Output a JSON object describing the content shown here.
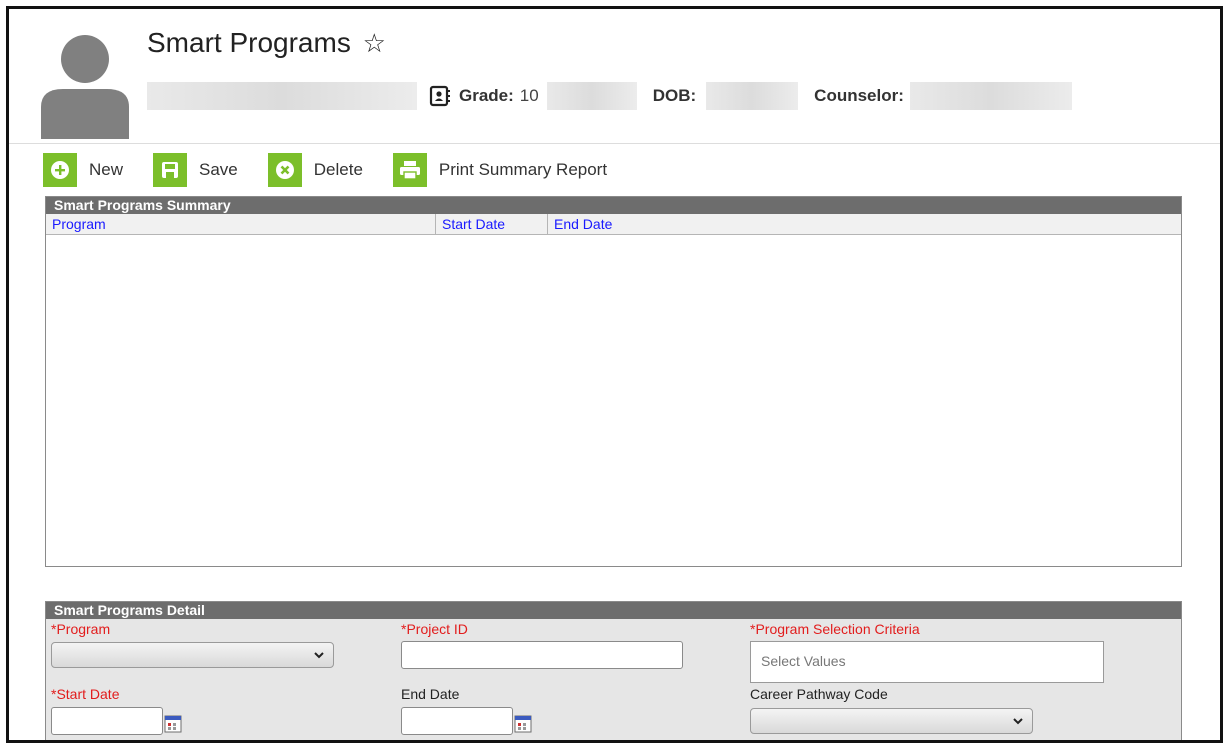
{
  "header": {
    "title": "Smart Programs",
    "grade_label": "Grade:",
    "grade_value": "10",
    "dob_label": "DOB:",
    "counselor_label": "Counselor:"
  },
  "toolbar": {
    "new_label": "New",
    "save_label": "Save",
    "delete_label": "Delete",
    "print_label": "Print Summary Report"
  },
  "summary": {
    "title": "Smart Programs Summary",
    "columns": [
      "Program",
      "Start Date",
      "End Date"
    ]
  },
  "detail": {
    "title": "Smart Programs Detail",
    "program_label": "*Program",
    "project_id_label": "*Project ID",
    "criteria_label": "*Program Selection Criteria",
    "criteria_placeholder": "Select Values",
    "start_date_label": "*Start Date",
    "end_date_label": "End Date",
    "career_label": "Career Pathway Code"
  },
  "colors": {
    "accent_green": "#7cbf2a",
    "panel_header": "#6d6d6d",
    "required_red": "#e21d1d",
    "column_link": "#1a1aff"
  }
}
